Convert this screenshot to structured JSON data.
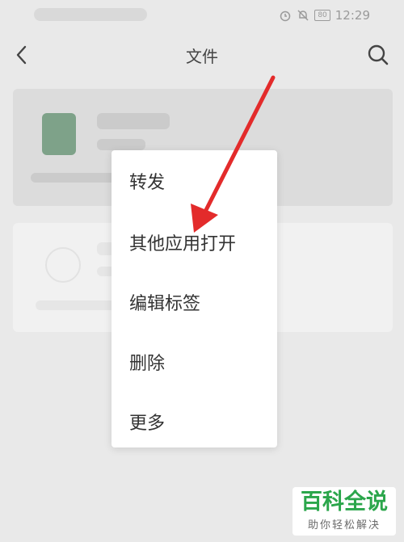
{
  "status_bar": {
    "battery": "80",
    "time": "12:29"
  },
  "header": {
    "title": "文件"
  },
  "context_menu": {
    "items": [
      {
        "label": "转发"
      },
      {
        "label": "其他应用打开"
      },
      {
        "label": "编辑标签"
      },
      {
        "label": "删除"
      },
      {
        "label": "更多"
      }
    ]
  },
  "watermark": {
    "title": "百科全说",
    "subtitle": "助你轻松解决"
  },
  "colors": {
    "arrow": "#e32b2b",
    "file_icon": "#5f8f6e",
    "watermark_green": "#2ba64b"
  },
  "icons": {
    "back": "chevron-left-icon",
    "search": "search-icon",
    "alarm": "alarm-icon",
    "mute": "bell-off-icon"
  }
}
